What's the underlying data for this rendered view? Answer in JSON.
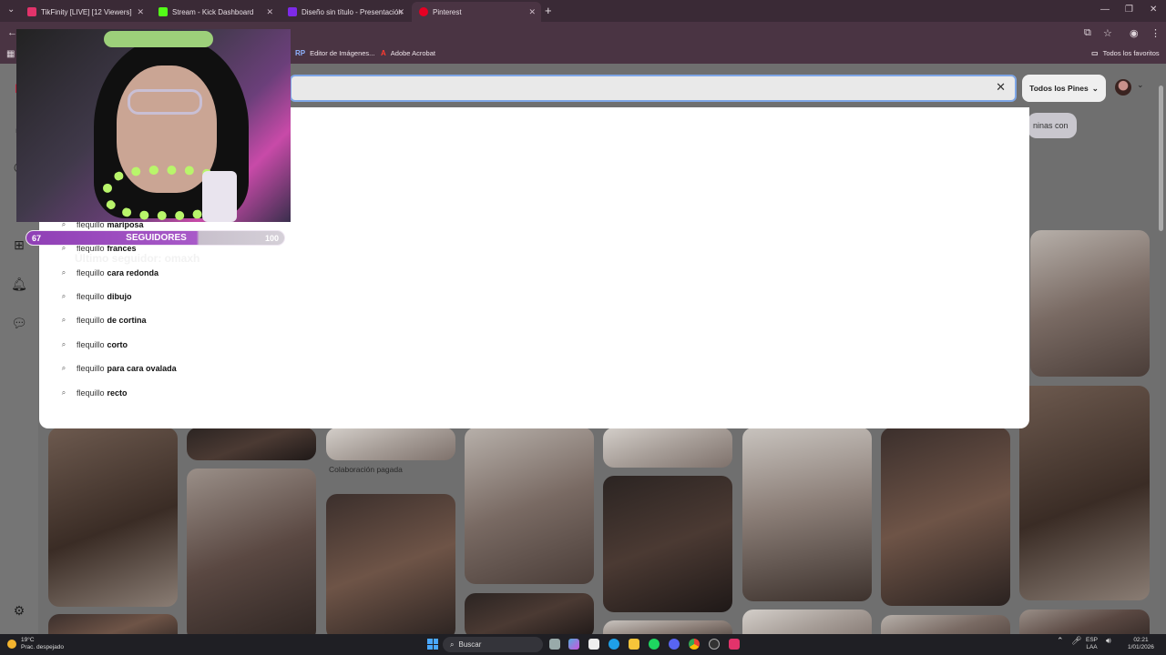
{
  "tabs": [
    {
      "title": "TikFinity [LIVE] [12 Viewers]",
      "favicon_color": "#e2336b"
    },
    {
      "title": "Stream - Kick Dashboard",
      "favicon_color": "#53fc18"
    },
    {
      "title": "Diseño sin título - Presentación",
      "favicon_color": "#7d2ae8"
    },
    {
      "title": "Pinterest",
      "favicon_color": "#e60023"
    }
  ],
  "bookmarks": [
    {
      "label": "Editor de Imágenes...",
      "icon": "RP"
    },
    {
      "label": "Adobe Acrobat",
      "icon": "A"
    },
    {
      "label": "Todos los favoritos",
      "icon": "folder-icon"
    }
  ],
  "search": {
    "value": "",
    "clear_icon": "✕",
    "filter_label": "Todos los Pines",
    "chip_text": "ninas con"
  },
  "suggestions": [
    {
      "prefix": "flequillo",
      "suffix": "mariposa"
    },
    {
      "prefix": "flequillo",
      "suffix": "frances"
    },
    {
      "prefix": "flequillo",
      "suffix": "cara redonda"
    },
    {
      "prefix": "flequillo",
      "suffix": "dibujo"
    },
    {
      "prefix": "flequillo",
      "suffix": "de cortina"
    },
    {
      "prefix": "flequillo",
      "suffix": "corto"
    },
    {
      "prefix": "flequillo",
      "suffix": "para cara ovalada"
    },
    {
      "prefix": "flequillo",
      "suffix": "recto"
    }
  ],
  "paid_label": "Colaboración pagada",
  "overlay": {
    "followers_current": "67",
    "followers_label": "SEGUIDORES",
    "followers_goal": "100",
    "followers_progress": 0.67,
    "last_follower": "Último seguidor: omaxh"
  },
  "taskbar": {
    "temperature": "19°C",
    "weather": "Prac. despejado",
    "search_label": "Buscar",
    "lang_top": "ESP",
    "lang_bottom": "LAA",
    "time": "02:21",
    "date": "1/01/2026"
  },
  "colors": {
    "accent": "#7ea6e6",
    "pinterest": "#e60023",
    "overlay_purple": "#a85ac8"
  }
}
